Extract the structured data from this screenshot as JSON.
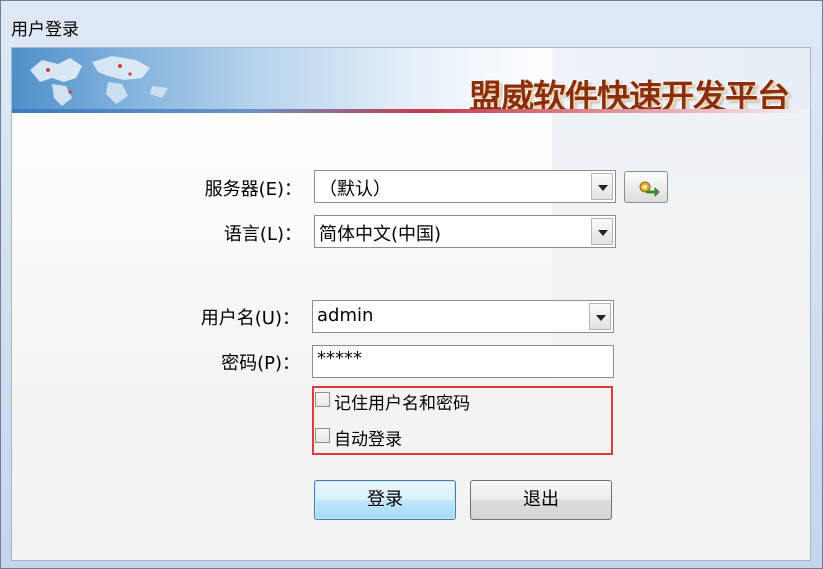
{
  "window": {
    "title": "用户登录"
  },
  "banner": {
    "title": "盟威软件快速开发平台"
  },
  "form": {
    "server_label": "服务器(E)：",
    "server_value": "（默认）",
    "language_label": "语言(L)：",
    "language_value": "简体中文(中国)",
    "username_label": "用户名(U)：",
    "username_value": "admin",
    "password_label": "密码(P)：",
    "password_value": "*****",
    "remember_label": "记住用户名和密码",
    "auto_login_label": "自动登录"
  },
  "buttons": {
    "login": "登录",
    "exit": "退出"
  },
  "colors": {
    "highlight_box": "#e03b3b",
    "banner_title": "#8a2e12",
    "primary_button_border": "#3c7fb1"
  },
  "icons": {
    "server_settings": "gear-arrow-icon",
    "dropdown": "chevron-down-icon"
  }
}
